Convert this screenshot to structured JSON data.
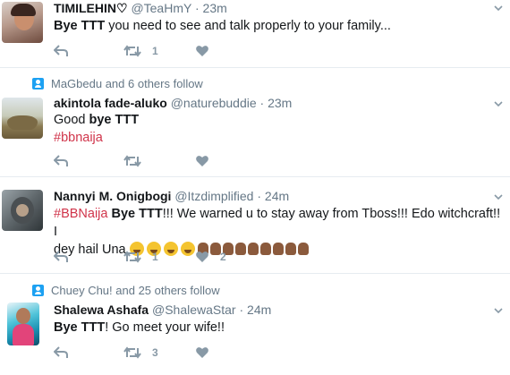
{
  "tweets": [
    {
      "name": "TIMILEHIN♡",
      "handle": "@TeaHmY",
      "dot": "·",
      "time": "23m",
      "text_parts": [
        {
          "t": "Bye TTT",
          "bold": true
        },
        {
          "t": " you need to see and talk properly to your family..."
        }
      ],
      "retweets": "1",
      "likes": ""
    },
    {
      "social": "MaGbedu and 6 others follow",
      "name": "akintola fade-aluko",
      "handle": "@naturebuddie",
      "dot": "·",
      "time": "23m",
      "line1": "Good ",
      "line1_bold": "bye TTT",
      "line2": "#bbnaija",
      "retweets": "",
      "likes": ""
    },
    {
      "name": "Nannyi M. Onigbogi",
      "handle": "@Itzdimplified",
      "dot": "·",
      "time": "24m",
      "tag": "#BBNaija",
      "bold": "Bye TTT",
      "rest": "!!! We warned u to stay away from Tboss!!! Edo witchcraft!! I",
      "line2": "dey hail Una ",
      "retweets": "1",
      "likes": "2"
    },
    {
      "social": "Chuey Chu! and 25 others follow",
      "name": "Shalewa Ashafa",
      "handle": "@ShalewaStar",
      "dot": "·",
      "time": "24m",
      "bold": "Bye TTT",
      "rest": "! Go meet your wife!!",
      "retweets": "3",
      "likes": ""
    }
  ],
  "icons": [
    "reply-icon",
    "retweet-icon",
    "like-icon",
    "chevron-down-icon",
    "follow-badge-icon"
  ],
  "colors": {
    "hashtag": "#d0344a",
    "muted": "#657786",
    "action": "#8899a6",
    "badge": "#1da1f2"
  }
}
